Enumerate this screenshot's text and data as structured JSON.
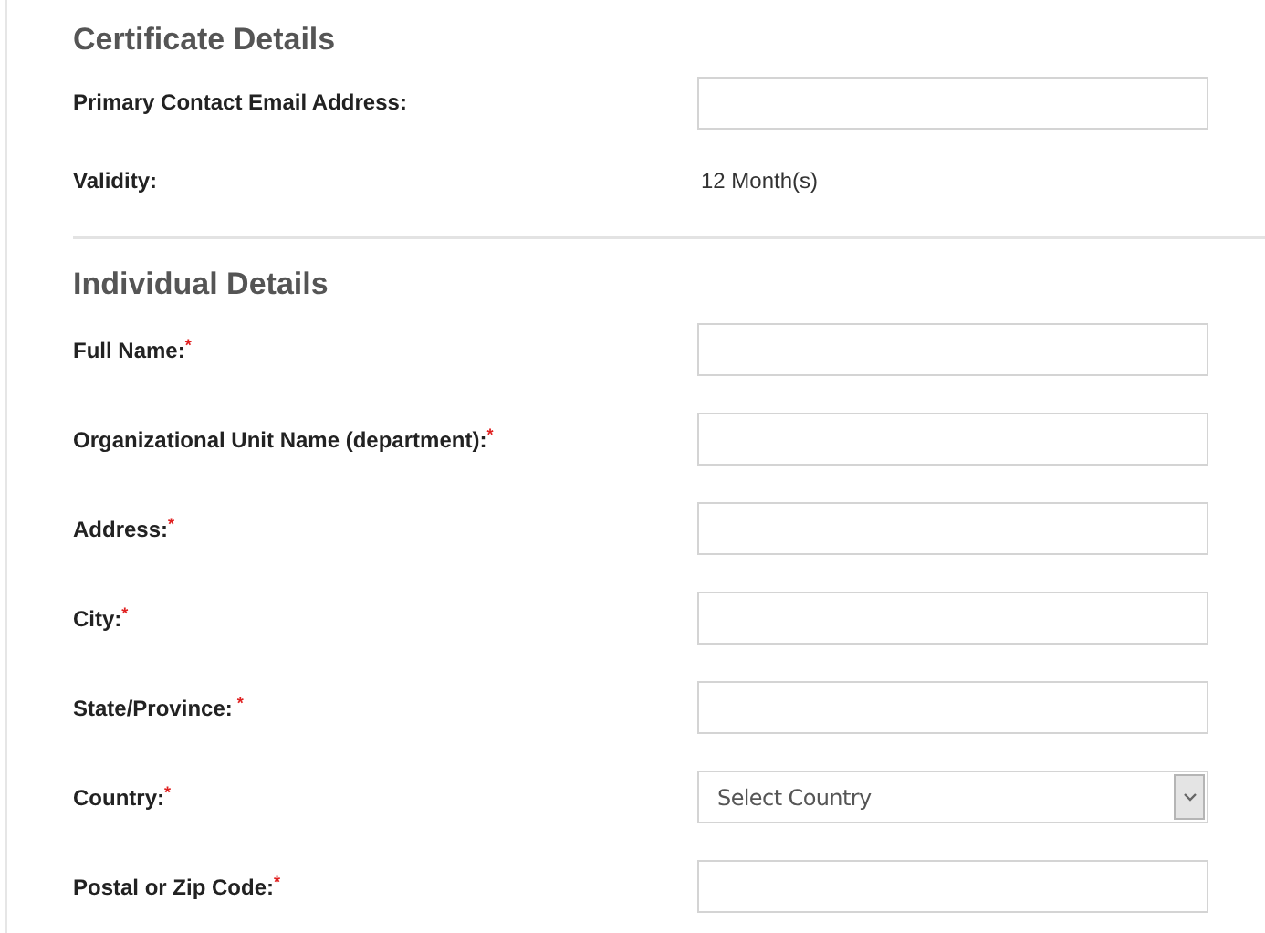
{
  "sections": [
    {
      "title": "Certificate Details",
      "fields": [
        {
          "kind": "input",
          "label": "Primary Contact Email Address:"
        },
        {
          "kind": "text",
          "label": "Validity:",
          "value": "12 Month(s)"
        }
      ]
    },
    {
      "title": "Individual Details",
      "fields": [
        {
          "kind": "input",
          "label": "Full Name:",
          "required_mark": "*"
        },
        {
          "kind": "input",
          "label": "Organizational Unit Name (department):",
          "required_mark": "*"
        },
        {
          "kind": "input",
          "label": "Address:",
          "required_mark": "*"
        },
        {
          "kind": "input",
          "label": "City:",
          "required_mark": "*"
        },
        {
          "kind": "input",
          "label": "State/Province:",
          "required_mark": " *"
        },
        {
          "kind": "select",
          "label": "Country:",
          "required_mark": "*",
          "value": "Select Country"
        },
        {
          "kind": "input",
          "label": "Postal or Zip Code:",
          "required_mark": "*"
        }
      ]
    }
  ]
}
